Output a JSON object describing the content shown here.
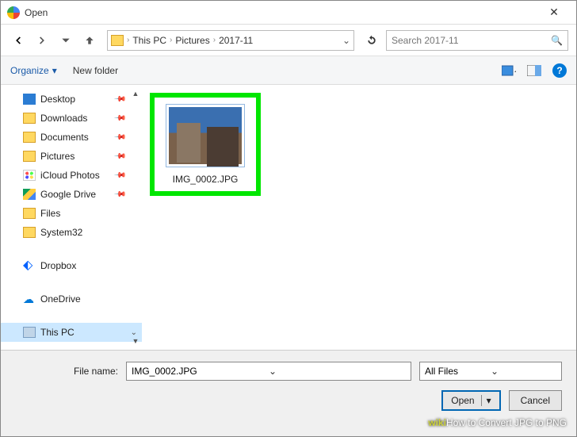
{
  "title": "Open",
  "breadcrumb": {
    "c1": "This PC",
    "c2": "Pictures",
    "c3": "2017-11"
  },
  "search": {
    "placeholder": "Search 2017-11"
  },
  "toolbar": {
    "organize": "Organize",
    "newfolder": "New folder"
  },
  "sidebar": {
    "items": [
      {
        "label": "Desktop"
      },
      {
        "label": "Downloads"
      },
      {
        "label": "Documents"
      },
      {
        "label": "Pictures"
      },
      {
        "label": "iCloud Photos"
      },
      {
        "label": "Google Drive"
      },
      {
        "label": "Files"
      },
      {
        "label": "System32"
      },
      {
        "label": "Dropbox"
      },
      {
        "label": "OneDrive"
      },
      {
        "label": "This PC"
      }
    ]
  },
  "file": {
    "name": "IMG_0002.JPG"
  },
  "footer": {
    "filenamelabel": "File name:",
    "filename": "IMG_0002.JPG",
    "filter": "All Files",
    "open": "Open",
    "cancel": "Cancel"
  },
  "watermark": {
    "prefix": "wiki",
    "text": "How to Convert JPG to PNG"
  }
}
